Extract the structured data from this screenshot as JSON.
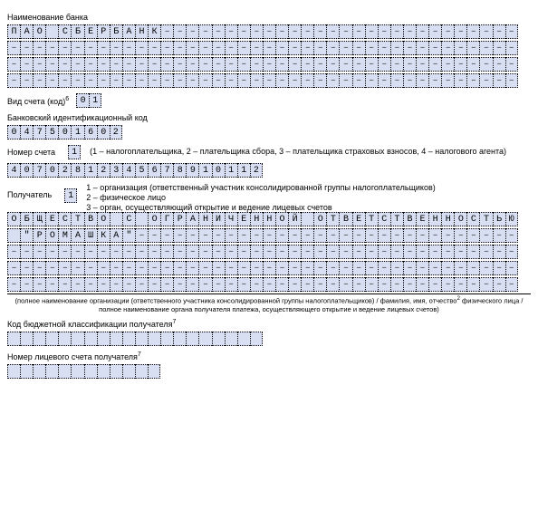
{
  "bank_name_label": "Наименование банка",
  "bank_name_rows": [
    [
      "П",
      "А",
      "О",
      "",
      "С",
      "Б",
      "Е",
      "Р",
      "Б",
      "А",
      "Н",
      "К",
      "–",
      "–",
      "–",
      "–",
      "–",
      "–",
      "–",
      "–",
      "–",
      "–",
      "–",
      "–",
      "–",
      "–",
      "–",
      "–",
      "–",
      "–",
      "–",
      "–",
      "–",
      "–",
      "–",
      "–",
      "–",
      "–",
      "–",
      "–"
    ],
    [
      "–",
      "–",
      "–",
      "–",
      "–",
      "–",
      "–",
      "–",
      "–",
      "–",
      "–",
      "–",
      "–",
      "–",
      "–",
      "–",
      "–",
      "–",
      "–",
      "–",
      "–",
      "–",
      "–",
      "–",
      "–",
      "–",
      "–",
      "–",
      "–",
      "–",
      "–",
      "–",
      "–",
      "–",
      "–",
      "–",
      "–",
      "–",
      "–",
      "–"
    ],
    [
      "–",
      "–",
      "–",
      "–",
      "–",
      "–",
      "–",
      "–",
      "–",
      "–",
      "–",
      "–",
      "–",
      "–",
      "–",
      "–",
      "–",
      "–",
      "–",
      "–",
      "–",
      "–",
      "–",
      "–",
      "–",
      "–",
      "–",
      "–",
      "–",
      "–",
      "–",
      "–",
      "–",
      "–",
      "–",
      "–",
      "–",
      "–",
      "–",
      "–"
    ],
    [
      "–",
      "–",
      "–",
      "–",
      "–",
      "–",
      "–",
      "–",
      "–",
      "–",
      "–",
      "–",
      "–",
      "–",
      "–",
      "–",
      "–",
      "–",
      "–",
      "–",
      "–",
      "–",
      "–",
      "–",
      "–",
      "–",
      "–",
      "–",
      "–",
      "–",
      "–",
      "–",
      "–",
      "–",
      "–",
      "–",
      "–",
      "–",
      "–",
      "–"
    ]
  ],
  "account_type_label": "Вид счета (код)",
  "account_type_sup": "6",
  "account_type_value": [
    "0",
    "1"
  ],
  "bik_label": "Банковский идентификационный код",
  "bik_value": [
    "0",
    "4",
    "7",
    "5",
    "0",
    "1",
    "6",
    "0",
    "2"
  ],
  "acct_no_label": "Номер счета",
  "acct_no_value": [
    "1"
  ],
  "acct_no_hint": "(1 – налогоплательщика, 2 – плательщика сбора, 3 – плательщика страховых взносов, 4 – налогового агента)",
  "big_account": [
    "4",
    "0",
    "7",
    "0",
    "2",
    "8",
    "1",
    "2",
    "3",
    "4",
    "5",
    "6",
    "7",
    "8",
    "9",
    "1",
    "0",
    "1",
    "1",
    "2"
  ],
  "recipient_label": "Получатель",
  "recipient_code": [
    "1"
  ],
  "recipient_hints": [
    "1 – организация (ответственный участник консолидированной группы налогоплательщиков)",
    "2 – физическое лицо",
    "3 – орган, осуществляющий открытие и ведение лицевых счетов"
  ],
  "recipient_rows": [
    [
      "О",
      "Б",
      "Щ",
      "Е",
      "С",
      "Т",
      "В",
      "О",
      "",
      "С",
      "",
      "О",
      "Г",
      "Р",
      "А",
      "Н",
      "И",
      "Ч",
      "Е",
      "Н",
      "Н",
      "О",
      "Й",
      "",
      "О",
      "Т",
      "В",
      "Е",
      "Т",
      "С",
      "Т",
      "В",
      "Е",
      "Н",
      "Н",
      "О",
      "С",
      "Т",
      "Ь",
      "Ю"
    ],
    [
      "",
      "\"",
      "Р",
      "О",
      "М",
      "А",
      "Ш",
      "К",
      "А",
      "\"",
      "–",
      "–",
      "–",
      "–",
      "–",
      "–",
      "–",
      "–",
      "–",
      "–",
      "–",
      "–",
      "–",
      "–",
      "–",
      "–",
      "–",
      "–",
      "–",
      "–",
      "–",
      "–",
      "–",
      "–",
      "–",
      "–",
      "–",
      "–",
      "–",
      "–"
    ],
    [
      "–",
      "–",
      "–",
      "–",
      "–",
      "–",
      "–",
      "–",
      "–",
      "–",
      "–",
      "–",
      "–",
      "–",
      "–",
      "–",
      "–",
      "–",
      "–",
      "–",
      "–",
      "–",
      "–",
      "–",
      "–",
      "–",
      "–",
      "–",
      "–",
      "–",
      "–",
      "–",
      "–",
      "–",
      "–",
      "–",
      "–",
      "–",
      "–",
      "–"
    ],
    [
      "–",
      "–",
      "–",
      "–",
      "–",
      "–",
      "–",
      "–",
      "–",
      "–",
      "–",
      "–",
      "–",
      "–",
      "–",
      "–",
      "–",
      "–",
      "–",
      "–",
      "–",
      "–",
      "–",
      "–",
      "–",
      "–",
      "–",
      "–",
      "–",
      "–",
      "–",
      "–",
      "–",
      "–",
      "–",
      "–",
      "–",
      "–",
      "–",
      "–"
    ],
    [
      "–",
      "–",
      "–",
      "–",
      "–",
      "–",
      "–",
      "–",
      "–",
      "–",
      "–",
      "–",
      "–",
      "–",
      "–",
      "–",
      "–",
      "–",
      "–",
      "–",
      "–",
      "–",
      "–",
      "–",
      "–",
      "–",
      "–",
      "–",
      "–",
      "–",
      "–",
      "–",
      "–",
      "–",
      "–",
      "–",
      "–",
      "–",
      "–",
      "–"
    ]
  ],
  "footnote_line1": "(полное наименование организации (ответственного участника консолидированной группы налогоплательщиков) / фамилия, имя, отчество",
  "footnote_sup": "2",
  "footnote_line1b": " физического лица /",
  "footnote_line2": "полное наименование органа получателя платежа, осуществляющего открытие и ведение лицевых счетов)",
  "kbk_label": "Код бюджетной классификации получателя",
  "kbk_sup": "7",
  "kbk_value": [
    "",
    "",
    "",
    "",
    "",
    "",
    "",
    "",
    "",
    "",
    "",
    "",
    "",
    "",
    "",
    "",
    "",
    "",
    "",
    ""
  ],
  "ls_label": "Номер лицевого счета получателя",
  "ls_sup": "7",
  "ls_value": [
    "",
    "",
    "",
    "",
    "",
    "",
    "",
    "",
    "",
    "",
    "",
    ""
  ]
}
